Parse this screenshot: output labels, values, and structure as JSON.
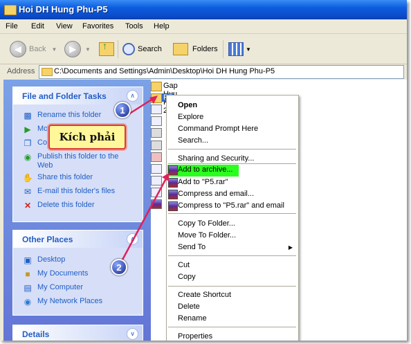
{
  "window": {
    "title": "Hoi DH Hung Phu-P5"
  },
  "menu": [
    "File",
    "Edit",
    "View",
    "Favorites",
    "Tools",
    "Help"
  ],
  "toolbar": {
    "back": "Back",
    "search": "Search",
    "folders": "Folders"
  },
  "address": {
    "label": "Address",
    "path": "C:\\Documents and Settings\\Admin\\Desktop\\Hoi DH Hung Phu-P5"
  },
  "file_tasks": {
    "title": "File and Folder Tasks",
    "items": [
      "Rename this folder",
      "Mo",
      "Co",
      "Publish this folder to the Web",
      "Share this folder",
      "E-mail this folder's files",
      "Delete this folder"
    ]
  },
  "other_places": {
    "title": "Other Places",
    "items": [
      "Desktop",
      "My Documents",
      "My Computer",
      "My Network Places"
    ]
  },
  "details": {
    "title": "Details"
  },
  "files": {
    "first": "Gap Huu P5-2017",
    "second": "P5"
  },
  "context_menu": {
    "open": "Open",
    "explore": "Explore",
    "cmd": "Command Prompt Here",
    "search": "Search...",
    "sharing": "Sharing and Security...",
    "add_archive": "Add to archive...",
    "add_rar": "Add to \"P5.rar\"",
    "compress_email": "Compress and email...",
    "compress_rar_email": "Compress to \"P5.rar\" and email",
    "copy_to": "Copy To Folder...",
    "move_to": "Move To Folder...",
    "send_to": "Send To",
    "cut": "Cut",
    "copy": "Copy",
    "create_shortcut": "Create Shortcut",
    "delete": "Delete",
    "rename": "Rename",
    "properties": "Properties"
  },
  "annotations": {
    "callout": "Kích phải",
    "step1": "1",
    "step2": "2"
  },
  "colors": {
    "titlebar": "#0a4bc9",
    "task_link": "#215dc6",
    "highlight": "#2bff1e",
    "callout_border": "#d93a3a",
    "arrow": "#e0205a"
  }
}
